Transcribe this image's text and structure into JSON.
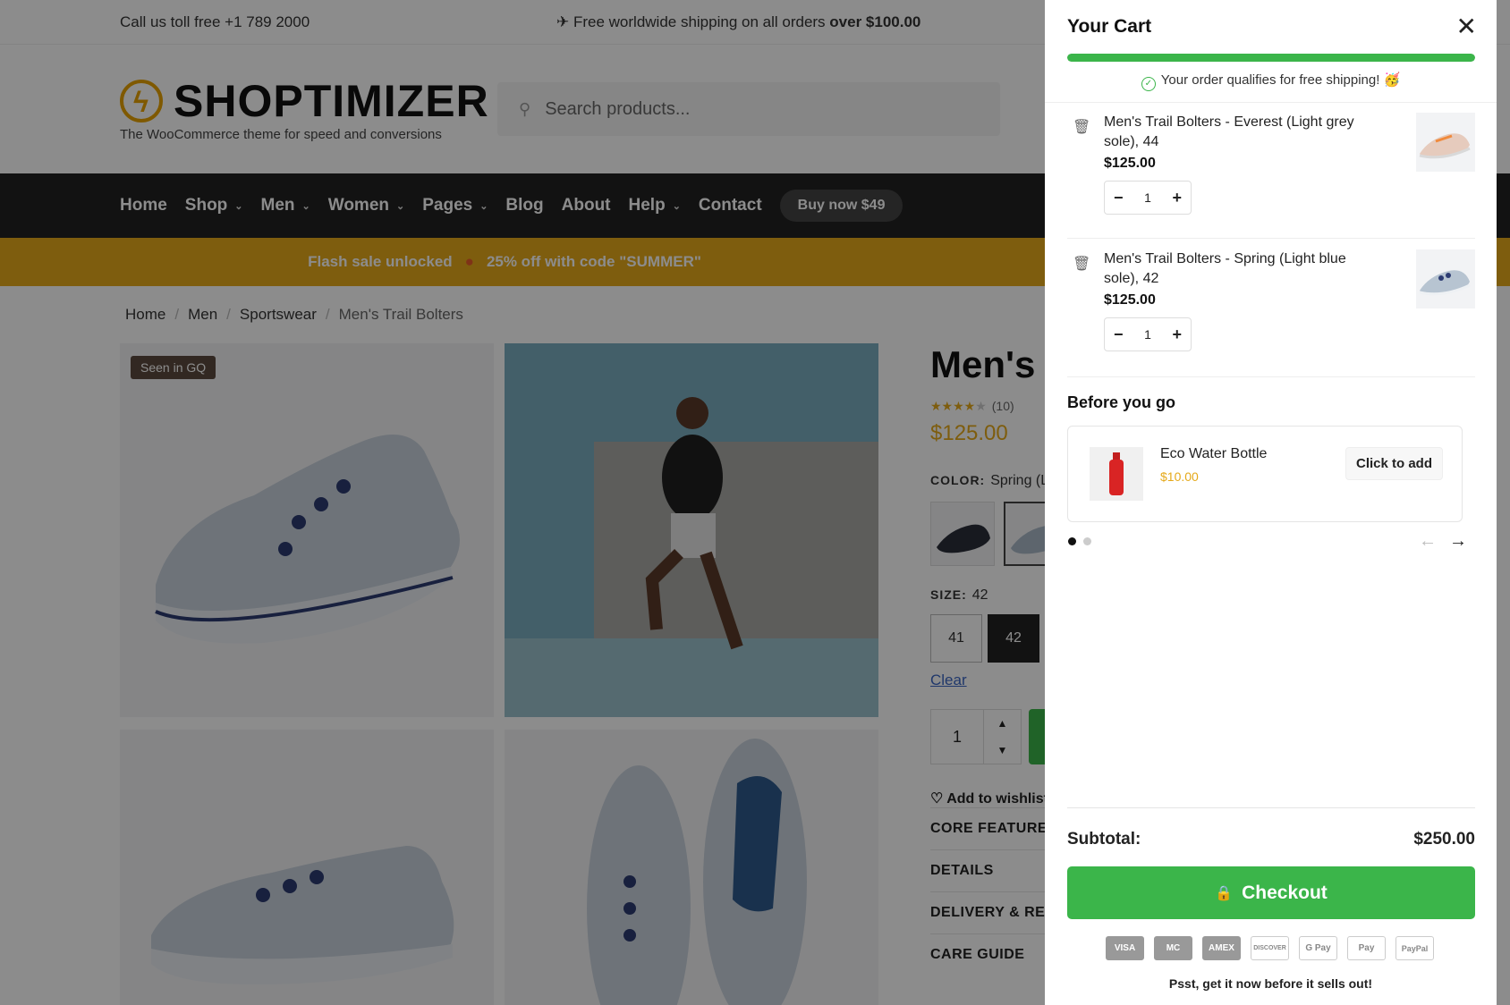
{
  "topbar": {
    "call": "Call us toll free +1 789 2000",
    "shipping_prefix": "✈ Free worldwide shipping on all orders",
    "shipping_bold": "over $100.00"
  },
  "logo": {
    "word": "SHOPTIMIZER",
    "tagline": "The WooCommerce theme for speed and conversions"
  },
  "search": {
    "placeholder": "Search products..."
  },
  "nav": {
    "items": [
      "Home",
      "Shop",
      "Men",
      "Women",
      "Pages",
      "Blog",
      "About",
      "Help",
      "Contact"
    ],
    "buy": "Buy now $49"
  },
  "flash": {
    "left": "Flash sale unlocked",
    "right": "25% off with code \"SUMMER\""
  },
  "breadcrumb": [
    "Home",
    "Men",
    "Sportswear",
    "Men's Trail Bolters"
  ],
  "gallery": {
    "badge": "Seen in GQ"
  },
  "product": {
    "title": "Men's T",
    "rating_count": "(10)",
    "price": "$125.00",
    "color_label": "COLOR:",
    "color_value": "Spring (L",
    "size_label": "SIZE:",
    "size_value": "42",
    "sizes": [
      "41",
      "42"
    ],
    "clear": "Clear",
    "qty": "1",
    "wishlist": "Add to wishlist",
    "accordion": [
      "CORE FEATURES",
      "DETAILS",
      "DELIVERY & RETU",
      "CARE GUIDE"
    ]
  },
  "cart": {
    "title": "Your Cart",
    "free_progress": 1.0,
    "free_msg": "Your order qualifies for free shipping! 🥳",
    "items": [
      {
        "name": "Men's Trail Bolters - Everest (Light grey sole), 44",
        "price": "$125.00",
        "qty": "1"
      },
      {
        "name": "Men's Trail Bolters - Spring (Light blue sole), 42",
        "price": "$125.00",
        "qty": "1"
      }
    ],
    "before_title": "Before you go",
    "upsell": {
      "name": "Eco Water Bottle",
      "price": "$10.00",
      "button": "Click to add"
    },
    "subtotal_label": "Subtotal:",
    "subtotal_value": "$250.00",
    "checkout": "Checkout",
    "payments": [
      "VISA",
      "MC",
      "AMEX",
      "DISCOVER",
      "G Pay",
      "Pay",
      "PayPal"
    ],
    "psst": "Psst, get it now before it sells out!"
  },
  "colors": {
    "accent": "#3bb54a",
    "brand": "#e5a91a",
    "nav_bg": "#222222"
  }
}
